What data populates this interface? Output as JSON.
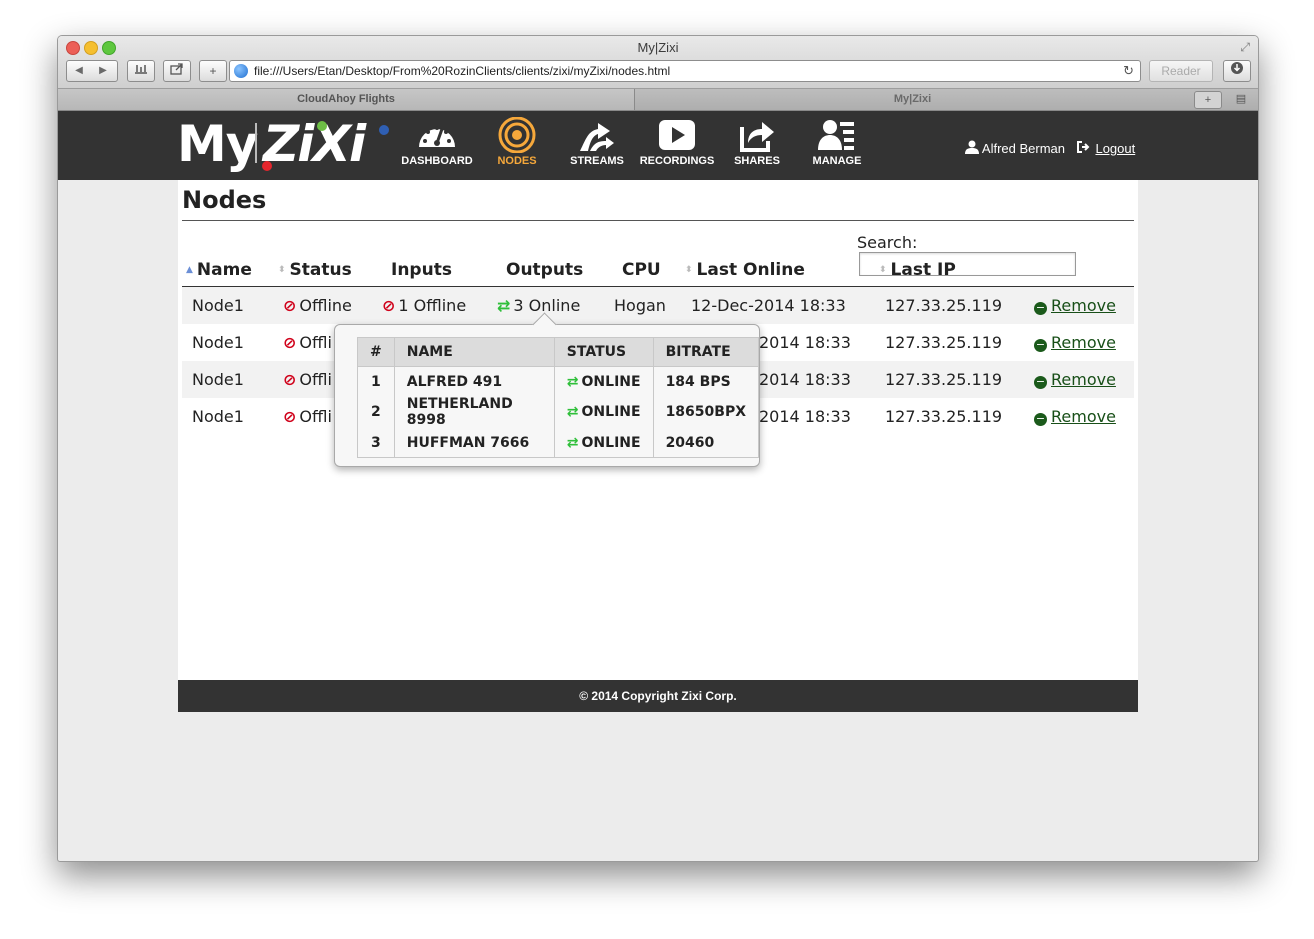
{
  "browser": {
    "window_title": "My|Zixi",
    "url": "file:///Users/Etan/Desktop/From%20RozinClients/clients/zixi/myZixi/nodes.html",
    "reader_label": "Reader",
    "tabs": [
      {
        "label": "CloudAhoy Flights"
      },
      {
        "label": "My|Zixi"
      }
    ]
  },
  "header": {
    "logo_my": "My",
    "logo_zixi": "ZiXi",
    "nav": [
      {
        "label": "DASHBOARD",
        "icon": "gauge-icon"
      },
      {
        "label": "NODES",
        "icon": "target-icon",
        "active": true
      },
      {
        "label": "STREAMS",
        "icon": "streams-icon"
      },
      {
        "label": "RECORDINGS",
        "icon": "play-icon"
      },
      {
        "label": "SHARES",
        "icon": "share-icon"
      },
      {
        "label": "MANAGE",
        "icon": "users-icon"
      }
    ],
    "user_name": "Alfred Berman",
    "logout_label": "Logout",
    "active_color": "#f6a83b",
    "bg_color": "#333333"
  },
  "page": {
    "title": "Nodes",
    "search_label": "Search:",
    "search_value": ""
  },
  "table": {
    "columns": [
      "Name",
      "Status",
      "Inputs",
      "Outputs",
      "CPU",
      "Last Online",
      "Last IP"
    ],
    "rows": [
      {
        "name": "Node1",
        "status": "Offline",
        "inputs": "1 Offline",
        "outputs": "3 Online",
        "cpu": "Hogan",
        "last_online": "12-Dec-2014 18:33",
        "last_ip": "127.33.25.119",
        "action": "Remove"
      },
      {
        "name": "Node1",
        "status": "Offli",
        "last_online": "2014 18:33",
        "last_ip": "127.33.25.119",
        "action": "Remove"
      },
      {
        "name": "Node1",
        "status": "Offli",
        "last_online": "2014 18:33",
        "last_ip": "127.33.25.119",
        "action": "Remove"
      },
      {
        "name": "Node1",
        "status": "Offli",
        "last_online": "2014 18:33",
        "last_ip": "127.33.25.119",
        "action": "Remove"
      }
    ]
  },
  "popover": {
    "columns": [
      "#",
      "NAME",
      "STATUS",
      "BITRATE"
    ],
    "rows": [
      {
        "num": "1",
        "name": "ALFRED 491",
        "status": "ONLINE",
        "bitrate": "184 BPS"
      },
      {
        "num": "2",
        "name": "NETHERLAND 8998",
        "status": "ONLINE",
        "bitrate": "18650BPX"
      },
      {
        "num": "3",
        "name": "HUFFMAN 7666",
        "status": "ONLINE",
        "bitrate": "20460"
      }
    ]
  },
  "footer": {
    "text": "© 2014 Copyright Zixi Corp."
  },
  "colors": {
    "offline": "#d0021b",
    "online": "#2fbf3a",
    "remove": "#184f18"
  }
}
